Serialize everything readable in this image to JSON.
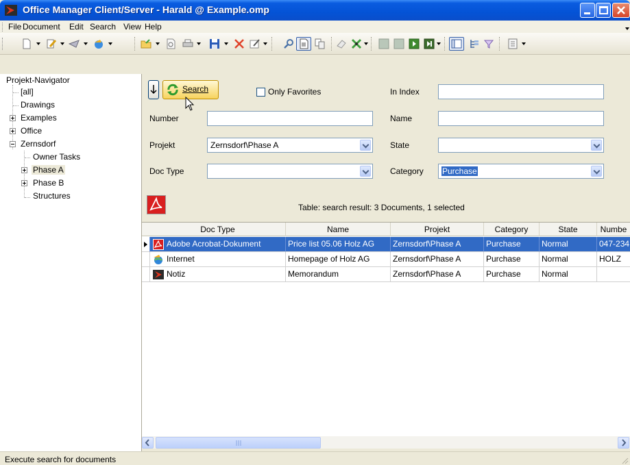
{
  "window": {
    "title": "Office Manager Client/Server - Harald @ Example.omp",
    "accent": "#0a5ce0"
  },
  "menu": [
    "File",
    "Document",
    "Edit",
    "Search",
    "View",
    "Help"
  ],
  "navigator": {
    "title": "Projekt-Navigator",
    "items": [
      "[all]",
      "Drawings",
      "Examples",
      "Office",
      "Zernsdorf",
      "Owner Tasks",
      "Phase A",
      "Phase B",
      "Structures"
    ]
  },
  "search": {
    "button_label": "Search",
    "only_favorites_label": "Only Favorites",
    "in_index_label": "In Index",
    "in_index_value": "",
    "number_label": "Number",
    "number_value": "",
    "name_label": "Name",
    "name_value": "",
    "projekt_label": "Projekt",
    "projekt_value": "Zernsdorf\\Phase A",
    "state_label": "State",
    "state_value": "",
    "doctype_label": "Doc Type",
    "doctype_value": "",
    "category_label": "Category",
    "category_value": "Purchase"
  },
  "table": {
    "caption": "Table: search result: 3 Documents, 1 selected",
    "columns": [
      "Doc Type",
      "Name",
      "Projekt",
      "Category",
      "State",
      "Numbe"
    ],
    "rows": [
      {
        "doctype": "Adobe Acrobat-Dokument",
        "name": "Price list 05.06 Holz AG",
        "projekt": "Zernsdorf\\Phase A",
        "category": "Purchase",
        "state": "Normal",
        "number": "047-234",
        "icon": "pdf-icon"
      },
      {
        "doctype": "Internet",
        "name": "Homepage of Holz AG",
        "projekt": "Zernsdorf\\Phase A",
        "category": "Purchase",
        "state": "Normal",
        "number": "HOLZ",
        "icon": "internet-icon"
      },
      {
        "doctype": "Notiz",
        "name": "Memorandum",
        "projekt": "Zernsdorf\\Phase A",
        "category": "Purchase",
        "state": "Normal",
        "number": "",
        "icon": "note-icon"
      }
    ]
  },
  "status": {
    "text": "Execute search for documents"
  }
}
